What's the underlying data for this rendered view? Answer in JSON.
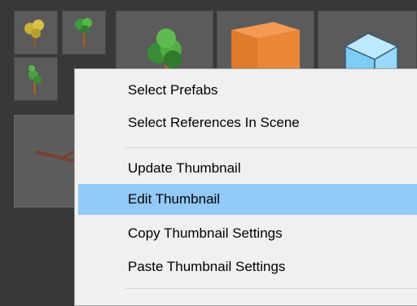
{
  "assets": [
    {
      "name": "yellow-tree-prefab"
    },
    {
      "name": "green-tree-prefab"
    },
    {
      "name": "small-tree-prefab"
    },
    {
      "name": "large-tree-prefab"
    },
    {
      "name": "orange-cube-prefab"
    },
    {
      "name": "blue-cube-prefab"
    },
    {
      "name": "branch-prefab"
    }
  ],
  "context_menu": {
    "items": [
      {
        "label": "Select Prefabs"
      },
      {
        "label": "Select References In Scene"
      },
      {
        "label": "Update Thumbnail"
      },
      {
        "label": "Edit Thumbnail",
        "highlighted": true
      },
      {
        "label": "Copy Thumbnail Settings"
      },
      {
        "label": "Paste Thumbnail Settings"
      }
    ]
  },
  "colors": {
    "panel_bg": "#383838",
    "tile_bg": "#5b5b5b",
    "menu_bg": "#f0f0f0",
    "highlight": "#91c9f7"
  }
}
